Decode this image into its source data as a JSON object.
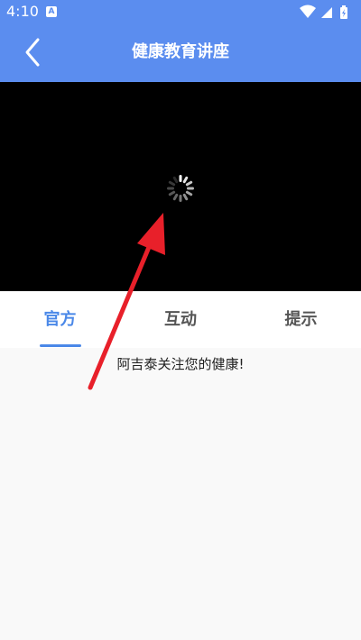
{
  "status_bar": {
    "time": "4:10",
    "notification_letter": "A",
    "icons": [
      "wifi-icon",
      "signal-icon",
      "battery-charging-icon"
    ]
  },
  "header": {
    "title": "健康教育讲座",
    "back_icon": "chevron-left-icon"
  },
  "video": {
    "state_icon": "loading-spinner-icon"
  },
  "tabs": [
    {
      "label": "官方",
      "active": true
    },
    {
      "label": "互动",
      "active": false
    },
    {
      "label": "提示",
      "active": false
    }
  ],
  "content": {
    "message": "阿吉泰关注您的健康!"
  },
  "colors": {
    "header_bg": "#5b8def",
    "accent": "#4a88e8",
    "annotation": "#e8202a"
  }
}
